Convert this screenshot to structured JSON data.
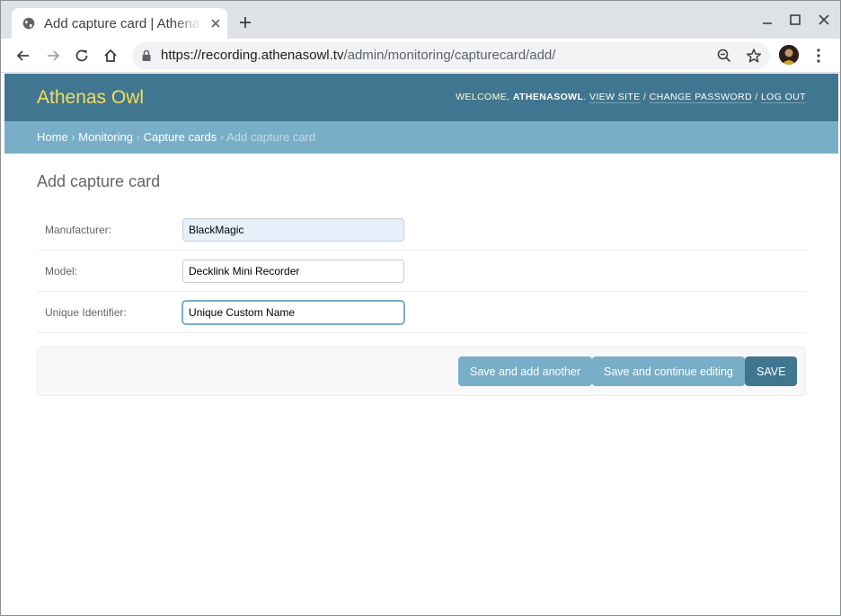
{
  "browser": {
    "tab_title": "Add capture card | Athenas Owl Recording",
    "url_host": "https://recording.athenasowl.tv",
    "url_path": "/admin/monitoring/capturecard/add/",
    "icons": {
      "favicon": "globe-icon",
      "tab_close": "close-icon",
      "new_tab": "plus-icon",
      "back": "arrow-left-icon",
      "forward": "arrow-right-icon",
      "reload": "reload-icon",
      "home": "home-icon",
      "lock": "lock-icon",
      "zoom": "zoom-icon",
      "bookmark": "star-icon",
      "menu": "kebab-menu-icon"
    }
  },
  "header": {
    "brand": "Athenas Owl",
    "welcome": "WELCOME,",
    "username": "ATHENASOWL",
    "view_site": "VIEW SITE",
    "change_password": "CHANGE PASSWORD",
    "log_out": "LOG OUT",
    "separator": "/"
  },
  "breadcrumbs": {
    "items": [
      "Home",
      "Monitoring",
      "Capture cards"
    ],
    "current": "Add capture card",
    "separator": "›"
  },
  "form": {
    "title": "Add capture card",
    "fields": [
      {
        "label": "Manufacturer:",
        "value": "BlackMagic"
      },
      {
        "label": "Model:",
        "value": "Decklink Mini Recorder"
      },
      {
        "label": "Unique Identifier:",
        "value": "Unique Custom Name"
      }
    ],
    "buttons": {
      "save_add_another": "Save and add another",
      "save_continue": "Save and continue editing",
      "save": "Save"
    }
  },
  "colors": {
    "header_bg": "#417690",
    "breadcrumb_bg": "#79aec8",
    "brand_yellow": "#f5dd5d",
    "button": "#79aec8",
    "button_default": "#417690"
  }
}
